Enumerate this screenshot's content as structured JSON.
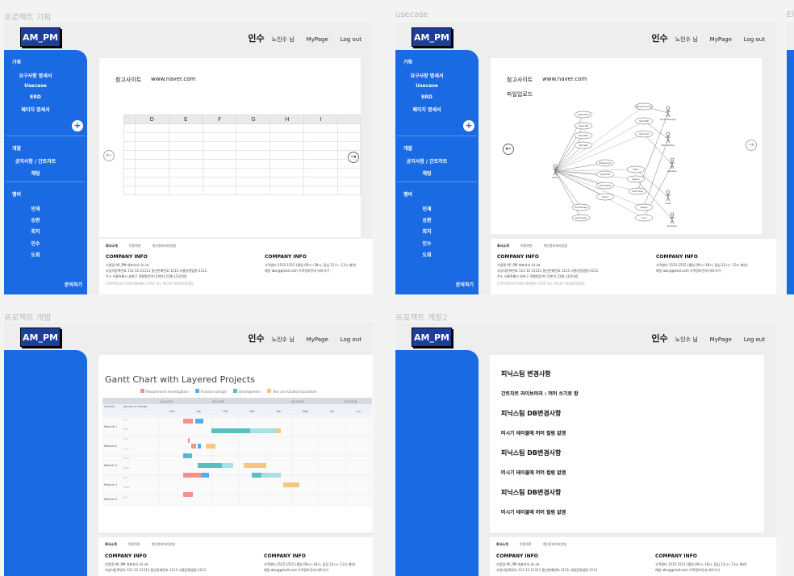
{
  "frames": [
    {
      "label": "프로젝트 기획"
    },
    {
      "label": "usecase"
    },
    {
      "label": "프로젝트 개발"
    },
    {
      "label": "프로젝트 개발2"
    },
    {
      "label": "El"
    }
  ],
  "app": {
    "logo": "AM_PM",
    "user_name": "인수",
    "user_suffix": "노인수 님",
    "mypage": "MyPage",
    "logout": "Log out"
  },
  "sidebar": {
    "plan_title": "기획",
    "plan_items": [
      "요구사항 명세서",
      "Usecase",
      "ERD",
      "페이지 명세서"
    ],
    "dev_title": "개발",
    "dev_items": [
      "공지사항 / 간트차트",
      "채팅"
    ],
    "member_title": "멤버",
    "member_items": [
      "민재",
      "승환",
      "회지",
      "인수",
      "도희"
    ],
    "contact": "문의하기"
  },
  "content": {
    "ref_label": "참고사이트",
    "ref_url": "www.naver.com",
    "upload_label": "파일업로드",
    "sheet_columns": [
      "",
      "D",
      "E",
      "F",
      "G",
      "H",
      "I",
      ""
    ],
    "arrow_left": "←",
    "arrow_right": "→"
  },
  "footer": {
    "tabs": [
      "회사소개",
      "이용약관",
      "개인정보처리방침"
    ],
    "left_title": "COMPANY INFO",
    "left_lines": [
      "기업명  AP_PM      대표자서  유니코",
      "사업자등록번호  111-11-11111    통신판매번호  1111-서울강항법원-1111",
      "주소  서울특별시 송파구 경향범진여 (1)번다 12층 L3강의장"
    ],
    "copyright": "COPYRIGHT©INFOBANK CORP. ALL RIGHT RESERVERD",
    "right_title": "COMPANY INFO",
    "right_lines": [
      "고객센터  1515.1515 (평일 09시~18시, 점심 12시~ 13시 제외)",
      "메일  abc@gmail.com          가족정보안내  바로가기"
    ]
  },
  "usecase": {
    "actors": [
      "Admin",
      "Project Manager",
      "Team Member",
      "Reviewer",
      "Guest",
      "Developer"
    ],
    "cases": [
      "Create Project",
      "Assign Task",
      "View Status",
      "Plan Tasks",
      "Manage Users",
      "Upload File",
      "Edit Schedule",
      "Report",
      "Send Message",
      "View Usecase",
      "Review Document",
      "Check ERD",
      "Team Chat",
      "Notice",
      "Approve",
      "Admin Panel",
      "Settings",
      "Log In"
    ]
  },
  "gantt": {
    "title": "Gantt Chart with Layered Projects",
    "legend": [
      {
        "label": "Requirement Investigation",
        "color": "#f2928c"
      },
      {
        "label": "Function Design",
        "color": "#5aa9ef"
      },
      {
        "label": "Development",
        "color": "#57c0c3"
      },
      {
        "label": "Test and Quality Guarantee",
        "color": "#f7c77e"
      }
    ],
    "quarters": [
      "Q4,2015",
      "Q1,2016",
      "Q2,2016",
      "Q3,2016"
    ],
    "months": [
      "Dec",
      "Jan",
      "Feb",
      "Mar",
      "Apr",
      "May",
      "Jun",
      "Jul"
    ],
    "head_module": "module",
    "head_person": "person in charge",
    "modules": [
      {
        "name": "Module 1",
        "people": [
          "Lily",
          "Bob"
        ]
      },
      {
        "name": "Module 2",
        "people": [
          "Tom",
          "Lucy"
        ]
      },
      {
        "name": "Module 3",
        "people": [
          "Alice",
          "Rose"
        ]
      },
      {
        "name": "Module 4",
        "people": [
          "Bill",
          "Mark"
        ]
      },
      {
        "name": "Module 5",
        "people": [
          "Jan"
        ]
      }
    ]
  },
  "notes": [
    {
      "heading": "피닉스팀 변경사항",
      "detail": "간트차트 라이브러리 : 머머 쓰기로 함"
    },
    {
      "heading": "피닉스팀 DB변경사항",
      "detail": "머시기 테이블에 머머 컬럼 없앰"
    },
    {
      "heading": "피닉스팀 DB변경사항",
      "detail": "머시기 테이블에 머머 컬럼 없앰"
    },
    {
      "heading": "피닉스팀 DB변경사항",
      "detail": "머시기 테이블에 머머 컬럼 없앰"
    }
  ]
}
